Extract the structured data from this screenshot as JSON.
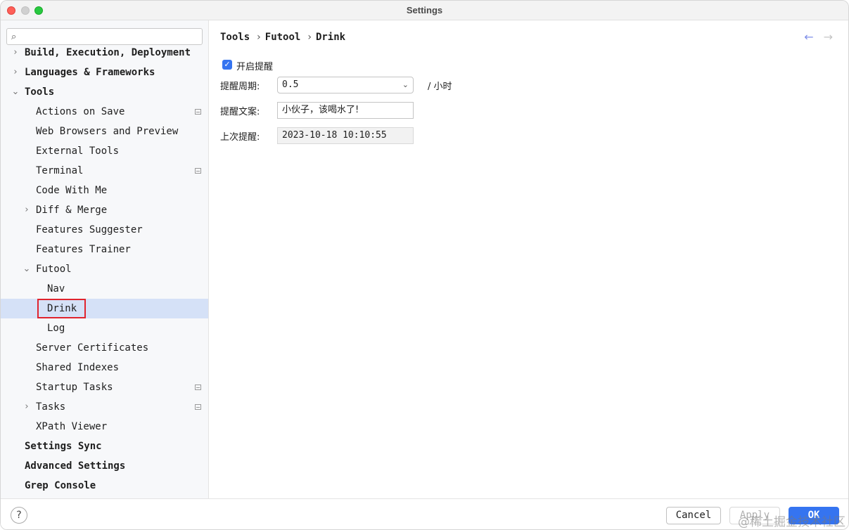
{
  "window": {
    "title": "Settings"
  },
  "search": {
    "placeholder": "",
    "value": ""
  },
  "tree": [
    {
      "label": "Build, Execution, Deployment",
      "level": 0,
      "bold": true,
      "chevron": "›"
    },
    {
      "label": "Languages & Frameworks",
      "level": 0,
      "bold": true,
      "chevron": "›"
    },
    {
      "label": "Tools",
      "level": 0,
      "bold": true,
      "chevron": "⌄"
    },
    {
      "label": "Actions on Save",
      "level": 1,
      "project": true
    },
    {
      "label": "Web Browsers and Preview",
      "level": 1
    },
    {
      "label": "External Tools",
      "level": 1
    },
    {
      "label": "Terminal",
      "level": 1,
      "project": true
    },
    {
      "label": "Code With Me",
      "level": 1
    },
    {
      "label": "Diff & Merge",
      "level": 1,
      "chevron": "›"
    },
    {
      "label": "Features Suggester",
      "level": 1
    },
    {
      "label": "Features Trainer",
      "level": 1
    },
    {
      "label": "Futool",
      "level": 1,
      "chevron": "⌄"
    },
    {
      "label": "Nav",
      "level": 2
    },
    {
      "label": "Drink",
      "level": 2,
      "selected": true
    },
    {
      "label": "Log",
      "level": 2
    },
    {
      "label": "Server Certificates",
      "level": 1
    },
    {
      "label": "Shared Indexes",
      "level": 1
    },
    {
      "label": "Startup Tasks",
      "level": 1,
      "project": true
    },
    {
      "label": "Tasks",
      "level": 1,
      "chevron": "›",
      "project": true
    },
    {
      "label": "XPath Viewer",
      "level": 1
    },
    {
      "label": "Settings Sync",
      "level": 0,
      "bold": true
    },
    {
      "label": "Advanced Settings",
      "level": 0,
      "bold": true
    },
    {
      "label": "Grep Console",
      "level": 0,
      "bold": true
    }
  ],
  "breadcrumb": {
    "part1": "Tools",
    "part2": "Futool",
    "part3": "Drink",
    "separator": "›"
  },
  "nav": {
    "back": "←",
    "forward": "→"
  },
  "form": {
    "enable_label": "开启提醒",
    "enable_checked": true,
    "period_label": "提醒周期:",
    "period_value": "0.5",
    "period_unit": "/ 小时",
    "text_label": "提醒文案:",
    "text_value": "小伙子，该喝水了!",
    "last_label": "上次提醒:",
    "last_value": "2023-10-18 10:10:55"
  },
  "footer": {
    "help": "?",
    "cancel": "Cancel",
    "apply": "Apply",
    "ok": "OK",
    "watermark": "@稀土掘金技术社区"
  },
  "colors": {
    "accent": "#3574f0",
    "selection": "#d5e1f7",
    "highlight_border": "#e0242e"
  }
}
